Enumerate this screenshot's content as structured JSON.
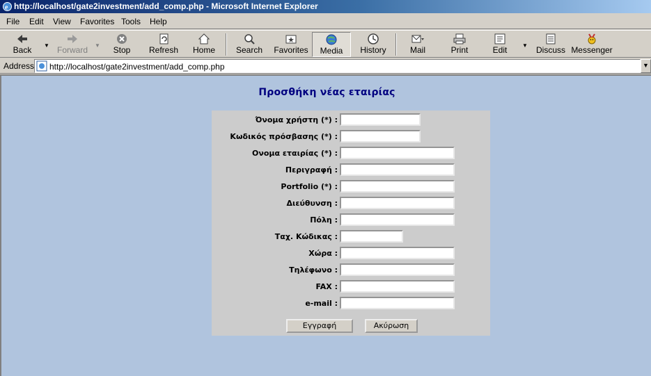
{
  "window": {
    "title": "http://localhost/gate2investment/add_comp.php - Microsoft Internet Explorer"
  },
  "menu": {
    "file": "File",
    "edit": "Edit",
    "view": "View",
    "favorites": "Favorites",
    "tools": "Tools",
    "help": "Help"
  },
  "toolbar": {
    "back": "Back",
    "forward": "Forward",
    "stop": "Stop",
    "refresh": "Refresh",
    "home": "Home",
    "search": "Search",
    "favorites": "Favorites",
    "media": "Media",
    "history": "History",
    "mail": "Mail",
    "print": "Print",
    "edit": "Edit",
    "discuss": "Discuss",
    "messenger": "Messenger"
  },
  "address": {
    "label": "Address",
    "url": "http://localhost/gate2investment/add_comp.php"
  },
  "page": {
    "title": "Προσθήκη νέας εταιρίας",
    "fields": [
      {
        "label": "Όνομα χρήστη (*) :",
        "value": ""
      },
      {
        "label": "Κωδικός πρόσβασης (*) :",
        "value": ""
      },
      {
        "label": "Ονομα εταιρίας (*) :",
        "value": ""
      },
      {
        "label": "Περιγραφή :",
        "value": ""
      },
      {
        "label": "Portfolio (*) :",
        "value": ""
      },
      {
        "label": "Διεύθυνση :",
        "value": ""
      },
      {
        "label": "Πόλη :",
        "value": ""
      },
      {
        "label": "Ταχ. Κώδικας :",
        "value": ""
      },
      {
        "label": "Χώρα :",
        "value": ""
      },
      {
        "label": "Τηλέφωνο :",
        "value": ""
      },
      {
        "label": "FAX :",
        "value": ""
      },
      {
        "label": "e-mail :",
        "value": ""
      }
    ],
    "submit": "Εγγραφή",
    "cancel": "Ακύρωση"
  }
}
